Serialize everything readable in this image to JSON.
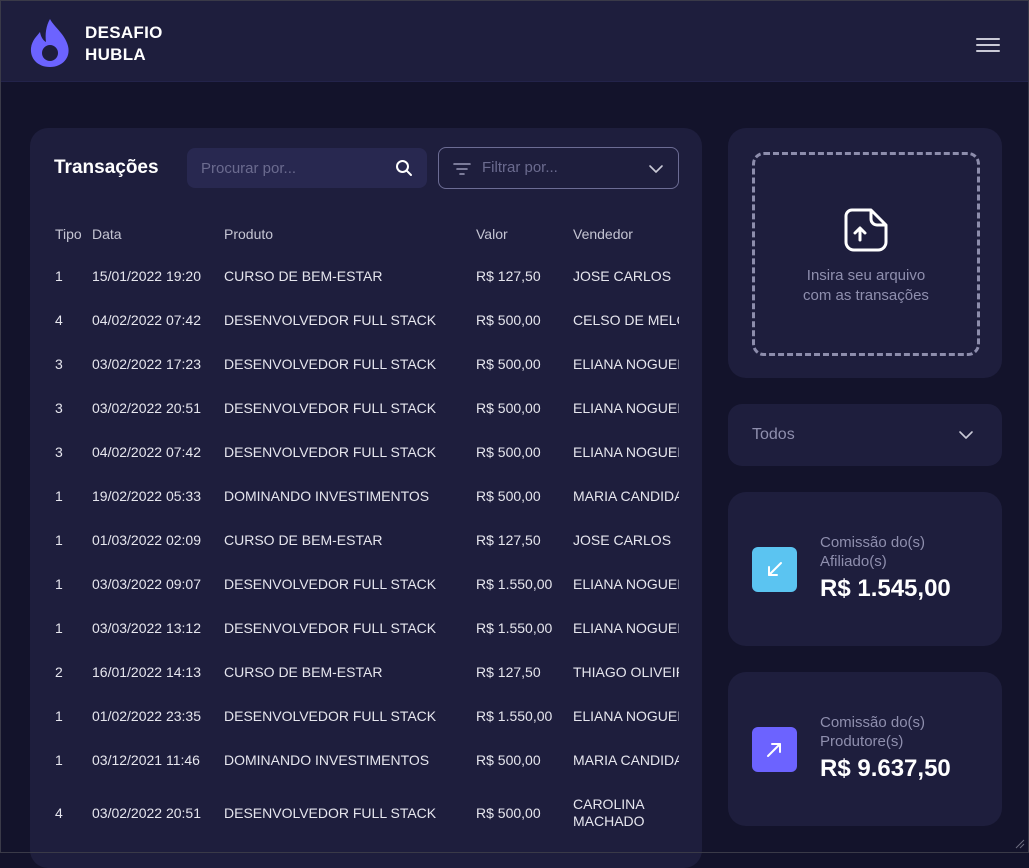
{
  "header": {
    "brand_line1": "DESAFIO",
    "brand_line2": "HUBLA",
    "logo_icon": "flame-icon",
    "menu_icon": "hamburger-menu-icon",
    "accent_color": "#6c63ff"
  },
  "transactions": {
    "title": "Transações",
    "search_placeholder": "Procurar por...",
    "filter_placeholder": "Filtrar por...",
    "columns": [
      "Tipo",
      "Data",
      "Produto",
      "Valor",
      "Vendedor"
    ],
    "rows": [
      {
        "tipo": "1",
        "data": "15/01/2022 19:20",
        "produto": "CURSO DE BEM-ESTAR",
        "valor": "R$ 127,50",
        "vendedor": "JOSE CARLOS"
      },
      {
        "tipo": "4",
        "data": "04/02/2022 07:42",
        "produto": "DESENVOLVEDOR FULL STACK",
        "valor": "R$ 500,00",
        "vendedor": "CELSO DE MELO"
      },
      {
        "tipo": "3",
        "data": "03/02/2022 17:23",
        "produto": "DESENVOLVEDOR FULL STACK",
        "valor": "R$ 500,00",
        "vendedor": "ELIANA NOGUEIRA"
      },
      {
        "tipo": "3",
        "data": "03/02/2022 20:51",
        "produto": "DESENVOLVEDOR FULL STACK",
        "valor": "R$ 500,00",
        "vendedor": "ELIANA NOGUEIRA"
      },
      {
        "tipo": "3",
        "data": "04/02/2022 07:42",
        "produto": "DESENVOLVEDOR FULL STACK",
        "valor": "R$ 500,00",
        "vendedor": "ELIANA NOGUEIRA"
      },
      {
        "tipo": "1",
        "data": "19/02/2022 05:33",
        "produto": "DOMINANDO INVESTIMENTOS",
        "valor": "R$ 500,00",
        "vendedor": "MARIA CANDIDA"
      },
      {
        "tipo": "1",
        "data": "01/03/2022 02:09",
        "produto": "CURSO DE BEM-ESTAR",
        "valor": "R$ 127,50",
        "vendedor": "JOSE CARLOS"
      },
      {
        "tipo": "1",
        "data": "03/03/2022 09:07",
        "produto": "DESENVOLVEDOR FULL STACK",
        "valor": "R$ 1.550,00",
        "vendedor": "ELIANA NOGUEIRA"
      },
      {
        "tipo": "1",
        "data": "03/03/2022 13:12",
        "produto": "DESENVOLVEDOR FULL STACK",
        "valor": "R$ 1.550,00",
        "vendedor": "ELIANA NOGUEIRA"
      },
      {
        "tipo": "2",
        "data": "16/01/2022 14:13",
        "produto": "CURSO DE BEM-ESTAR",
        "valor": "R$ 127,50",
        "vendedor": "THIAGO OLIVEIRA"
      },
      {
        "tipo": "1",
        "data": "01/02/2022 23:35",
        "produto": "DESENVOLVEDOR FULL STACK",
        "valor": "R$ 1.550,00",
        "vendedor": "ELIANA NOGUEIRA"
      },
      {
        "tipo": "1",
        "data": "03/12/2021 11:46",
        "produto": "DOMINANDO INVESTIMENTOS",
        "valor": "R$ 500,00",
        "vendedor": "MARIA CANDIDA"
      },
      {
        "tipo": "4",
        "data": "03/02/2022 20:51",
        "produto": "DESENVOLVEDOR FULL STACK",
        "valor": "R$ 500,00",
        "vendedor": "CAROLINA MACHADO"
      }
    ]
  },
  "upload": {
    "icon": "upload-file-icon",
    "text_line1": "Insira seu arquivo",
    "text_line2": "com as transações"
  },
  "filter_select": {
    "value": "Todos"
  },
  "stats": {
    "affiliates": {
      "label_line1": "Comissão do(s)",
      "label_line2": "Afiliado(s)",
      "value": "R$ 1.545,00",
      "icon": "arrow-down-left-icon",
      "color": "#5bc4f1"
    },
    "producers": {
      "label_line1": "Comissão do(s)",
      "label_line2": "Produtore(s)",
      "value": "R$ 9.637,50",
      "icon": "arrow-up-right-icon",
      "color": "#6c63ff"
    }
  }
}
